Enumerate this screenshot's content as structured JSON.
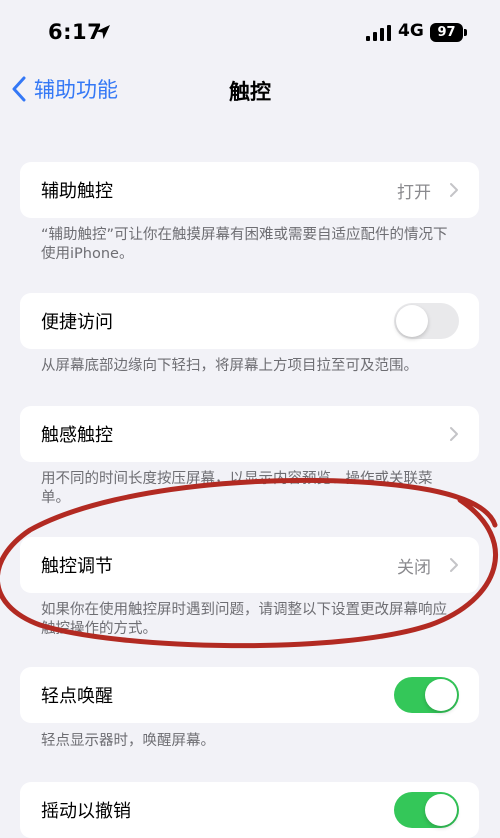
{
  "status_bar": {
    "time": "6:17",
    "network": "4G",
    "battery": "97"
  },
  "nav": {
    "back_label": "辅助功能",
    "title": "触控"
  },
  "rows": {
    "assistive_touch": {
      "label": "辅助触控",
      "value": "打开",
      "note": "“辅助触控”可让你在触摸屏幕有困难或需要自适应配件的情况下使用iPhone。"
    },
    "reachability": {
      "label": "便捷访问",
      "toggle_on": false,
      "note": "从屏幕底部边缘向下轻扫，将屏幕上方项目拉至可及范围。"
    },
    "haptic_touch": {
      "label": "触感触控",
      "note": "用不同的时间长度按压屏幕，以显示内容预览、操作或关联菜单。"
    },
    "touch_accommodations": {
      "label": "触控调节",
      "value": "关闭",
      "note": "如果你在使用触控屏时遇到问题，请调整以下设置更改屏幕响应触控操作的方式。"
    },
    "tap_to_wake": {
      "label": "轻点唤醒",
      "toggle_on": true,
      "note": "轻点显示器时，唤醒屏幕。"
    },
    "shake_to_undo": {
      "label": "摇动以撤销",
      "toggle_on": true
    }
  },
  "colors": {
    "accent": "#3478f6",
    "toggle_on": "#34c759",
    "annotation": "#b22a22"
  }
}
